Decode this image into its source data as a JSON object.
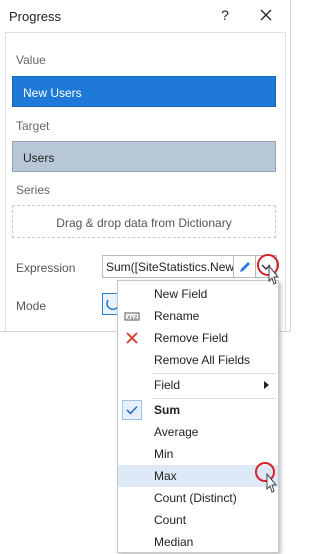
{
  "window": {
    "title": "Progress",
    "help_label": "?"
  },
  "form": {
    "value_label": "Value",
    "value_field": "New Users",
    "target_label": "Target",
    "target_field": "Users",
    "series_label": "Series",
    "series_placeholder": "Drag & drop data from Dictionary",
    "expression_label": "Expression",
    "expression_value": "Sum([SiteStatistics.New U",
    "mode_label": "Mode"
  },
  "menu": {
    "items": [
      {
        "label": "New Field",
        "icon": "none"
      },
      {
        "label": "Rename",
        "icon": "rename-icon"
      },
      {
        "label": "Remove Field",
        "icon": "remove-icon"
      },
      {
        "label": "Remove All Fields",
        "icon": "none"
      },
      {
        "label": "Field",
        "icon": "none",
        "submenu": true
      },
      {
        "label": "Sum",
        "icon": "check-icon",
        "checked": true
      },
      {
        "label": "Average"
      },
      {
        "label": "Min"
      },
      {
        "label": "Max",
        "hovered": true
      },
      {
        "label": "Count (Distinct)"
      },
      {
        "label": "Count"
      },
      {
        "label": "Median"
      }
    ]
  },
  "colors": {
    "accent": "#1e7ad6",
    "target_fill": "#b7c7d6",
    "highlight_ring": "#d8222a",
    "hover": "#dde9f6"
  }
}
